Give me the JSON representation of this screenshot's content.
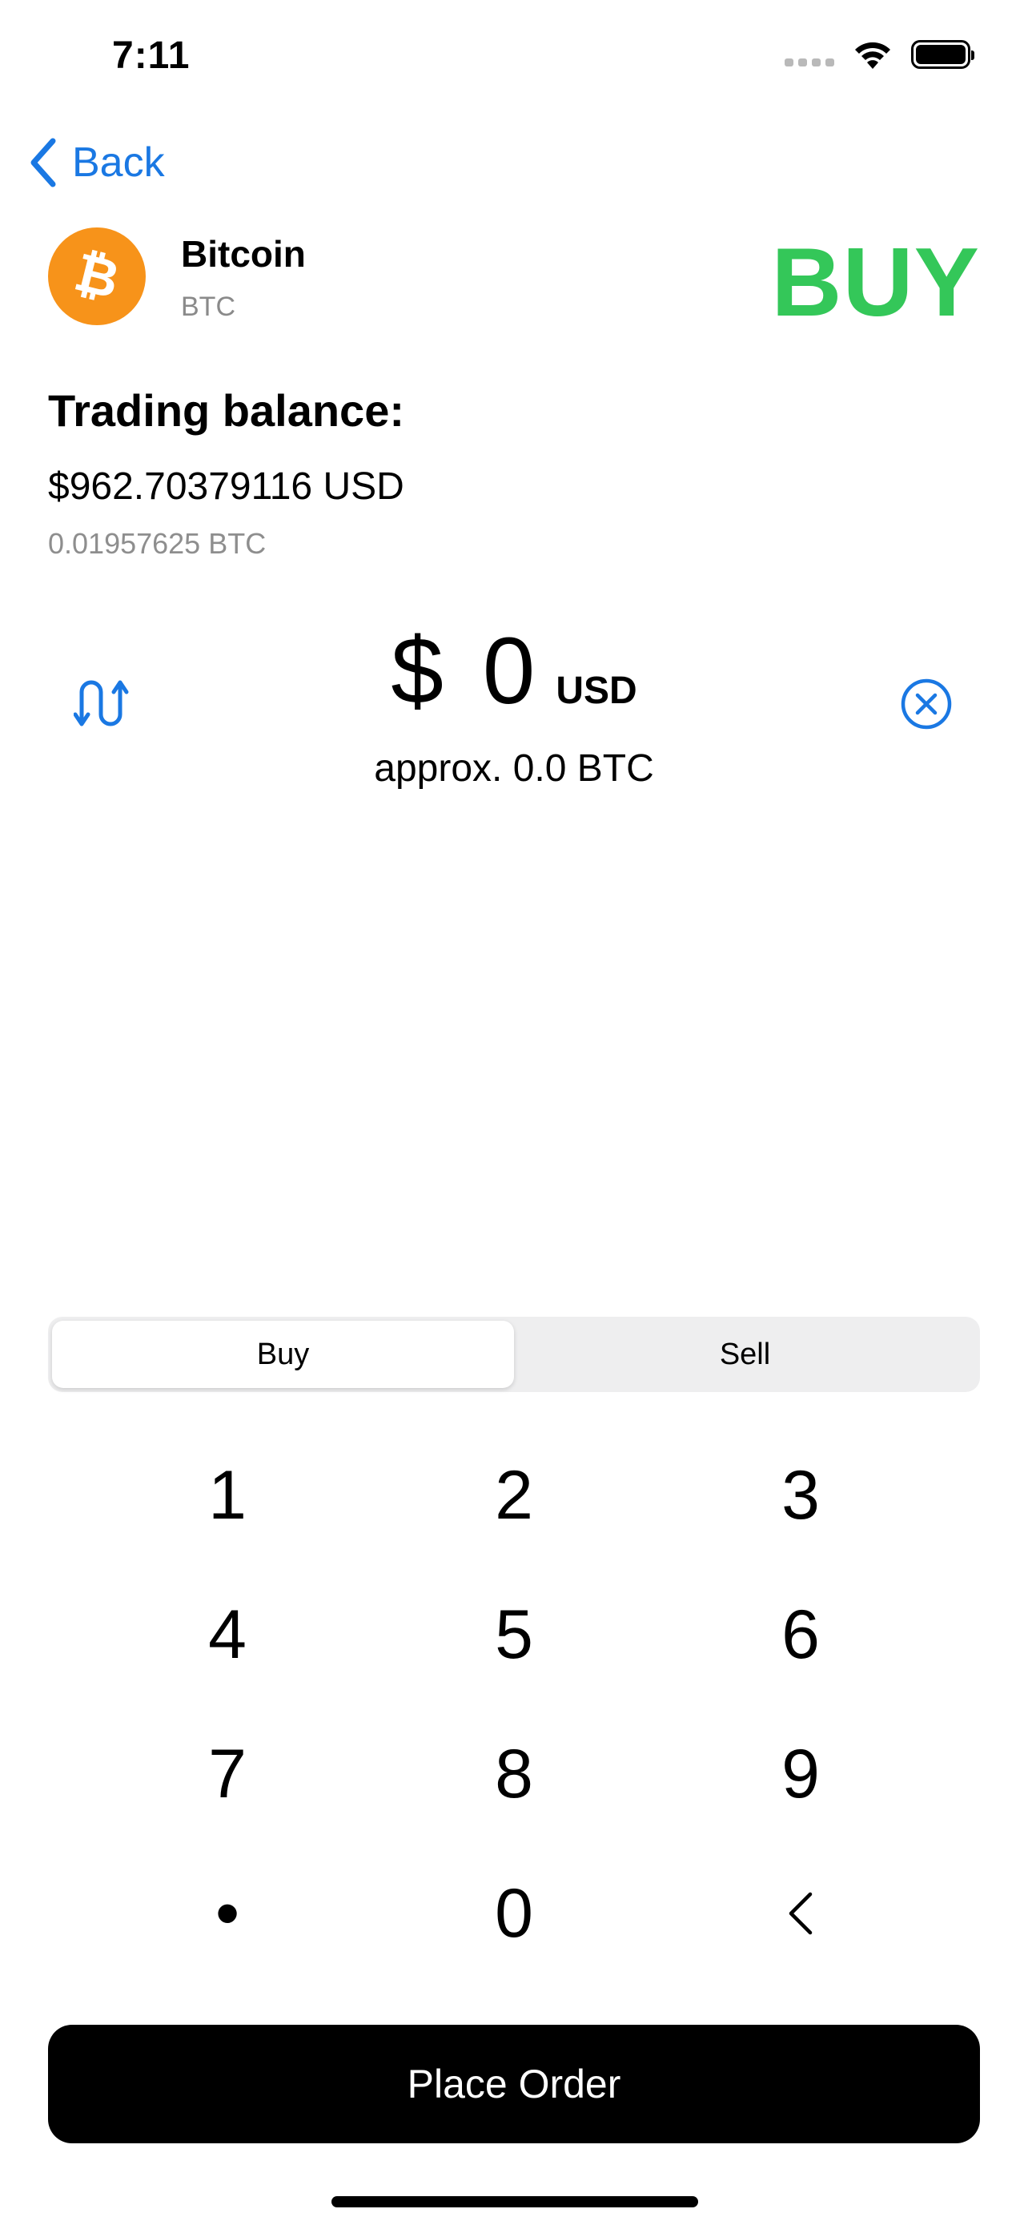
{
  "status_bar": {
    "time": "7:11",
    "icons": [
      "signal-icon",
      "wifi-icon",
      "battery-icon"
    ]
  },
  "nav": {
    "back_label": "Back",
    "back_icon": "chevron-left-icon"
  },
  "coin": {
    "name": "Bitcoin",
    "ticker": "BTC",
    "logo_icon": "bitcoin-icon",
    "logo_color": "#f7931a"
  },
  "mode_heading": {
    "text": "BUY",
    "color": "#34c759"
  },
  "balance": {
    "title": "Trading balance:",
    "usd": "$962.70379116 USD",
    "btc": "0.01957625 BTC"
  },
  "amount": {
    "value": "$ 0",
    "currency": "USD",
    "approx": "approx. 0.0 BTC",
    "swap_icon": "swap-arrows-icon",
    "clear_icon": "clear-circle-icon"
  },
  "segment": {
    "options": [
      "Buy",
      "Sell"
    ],
    "selected": "Buy"
  },
  "keypad": {
    "keys": [
      "1",
      "2",
      "3",
      "4",
      "5",
      "6",
      "7",
      "8",
      "9",
      "•",
      "0",
      "‹"
    ]
  },
  "actions": {
    "place_order": "Place Order"
  },
  "colors": {
    "accent": "#1a78e3",
    "buy_green": "#34c759"
  }
}
